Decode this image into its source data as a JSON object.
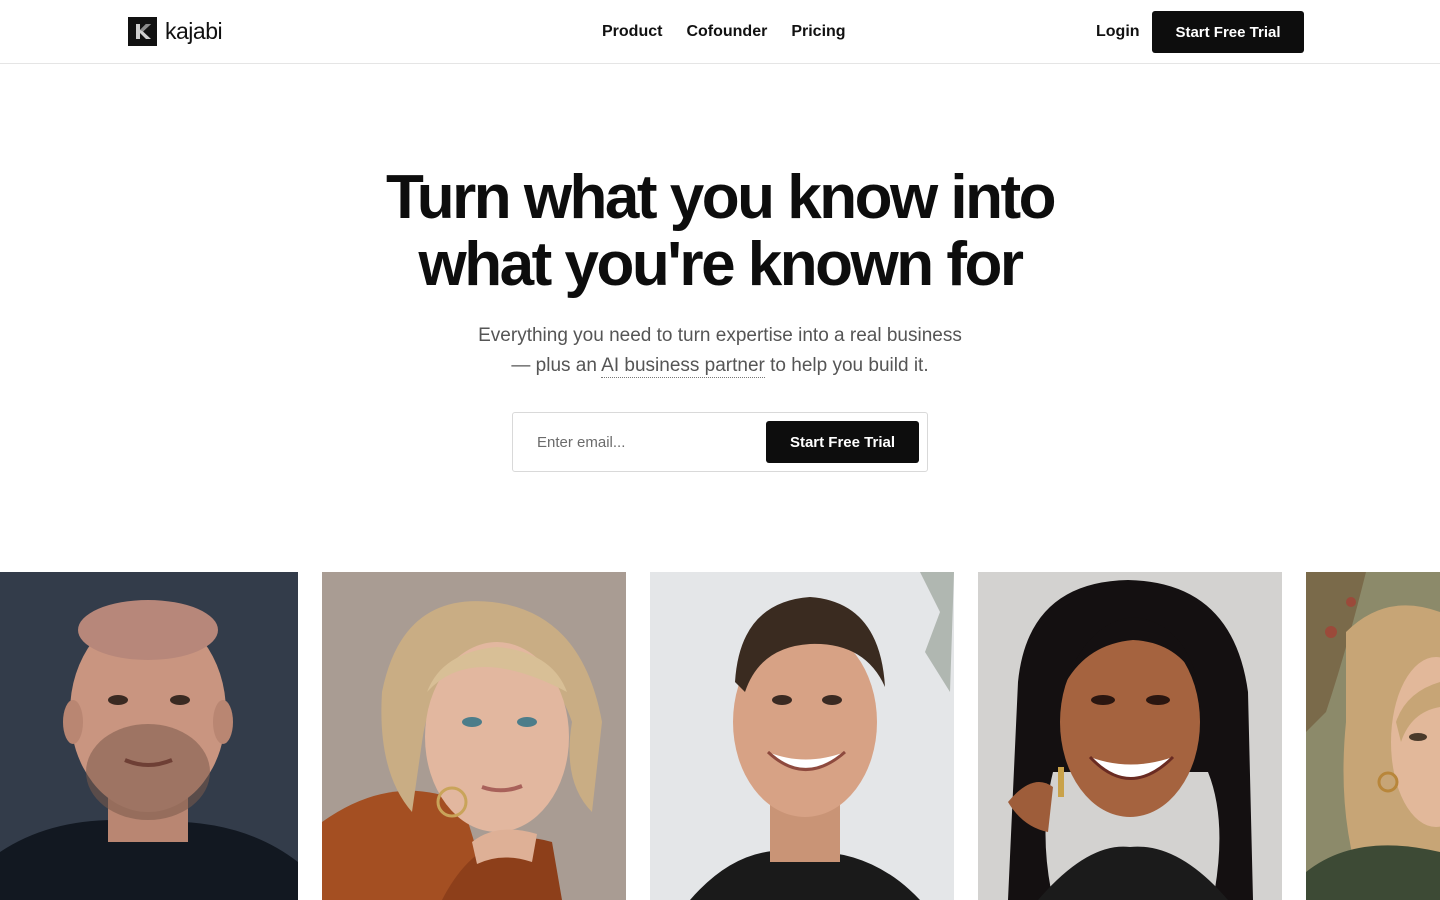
{
  "header": {
    "logo_text": "kajabi",
    "nav": [
      {
        "label": "Product"
      },
      {
        "label": "Cofounder"
      },
      {
        "label": "Pricing"
      }
    ],
    "login_label": "Login",
    "cta_label": "Start Free Trial"
  },
  "hero": {
    "title_line1": "Turn what you know into",
    "title_line2": "what you're known for",
    "subtitle_line1": "Everything you need to turn expertise into a real business",
    "subtitle_prefix": "— plus an",
    "subtitle_link": "AI business partner",
    "subtitle_suffix": "to help you build it."
  },
  "signup": {
    "email_placeholder": "Enter email...",
    "cta_label": "Start Free Trial"
  },
  "colors": {
    "primary": "#0d0d0d",
    "text_muted": "#555555",
    "border": "#e5e5e5"
  }
}
